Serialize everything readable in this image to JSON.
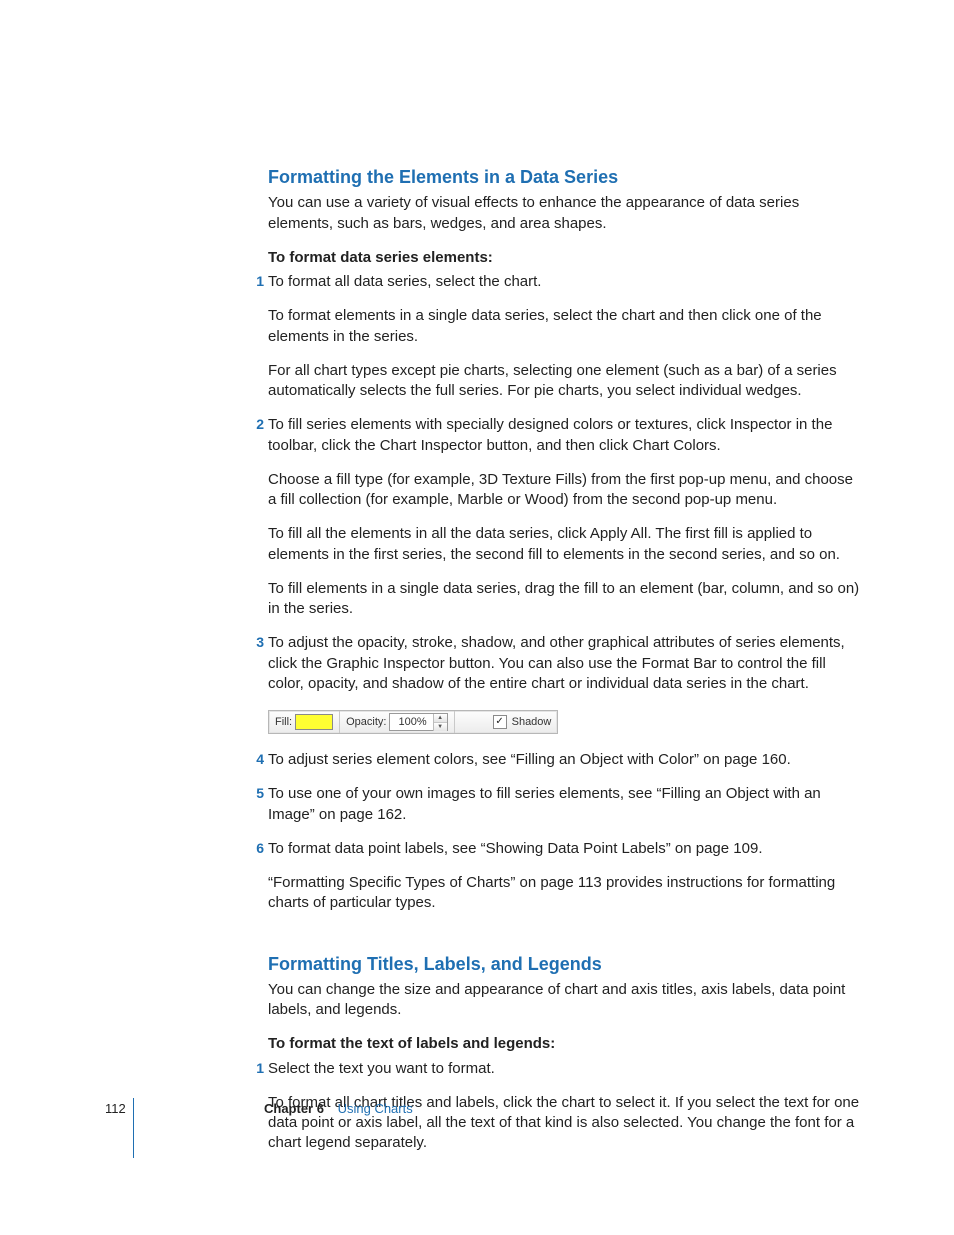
{
  "section1": {
    "heading": "Formatting the Elements in a Data Series",
    "intro": "You can use a variety of visual effects to enhance the appearance of data series elements, such as bars, wedges, and area shapes.",
    "subhead": "To format data series elements:",
    "steps": [
      {
        "num": "1",
        "paras": [
          "To format all data series, select the chart.",
          "To format elements in a single data series, select the chart and then click one of the elements in the series.",
          "For all chart types except pie charts, selecting one element (such as a bar) of a series automatically selects the full series. For pie charts, you select individual wedges."
        ]
      },
      {
        "num": "2",
        "paras": [
          "To fill series elements with specially designed colors or textures, click Inspector in the toolbar, click the Chart Inspector button, and then click Chart Colors.",
          "Choose a fill type (for example, 3D Texture Fills) from the first pop-up menu, and choose a fill collection (for example, Marble or Wood) from the second pop-up menu.",
          "To fill all the elements in all the data series, click Apply All. The first fill is applied to elements in the first series, the second fill to elements in the second series, and so on.",
          "To fill elements in a single data series, drag the fill to an element (bar, column, and so on) in the series."
        ]
      },
      {
        "num": "3",
        "paras": [
          "To adjust the opacity, stroke, shadow, and other graphical attributes of series elements, click the Graphic Inspector button. You can also use the Format Bar to control the fill color, opacity, and shadow of the entire chart or individual data series in the chart."
        ]
      },
      {
        "num": "4",
        "paras": [
          "To adjust series element colors, see “Filling an Object with Color” on page 160."
        ]
      },
      {
        "num": "5",
        "paras": [
          "To use one of your own images to fill series elements, see “Filling an Object with an Image” on page 162."
        ]
      },
      {
        "num": "6",
        "paras": [
          "To format data point labels, see “Showing Data Point Labels” on page 109.",
          "“Formatting Specific Types of Charts” on page 113 provides instructions for formatting charts of particular types."
        ]
      }
    ]
  },
  "formatbar": {
    "fill_label": "Fill:",
    "opacity_label": "Opacity:",
    "opacity_value": "100%",
    "shadow_label": "Shadow",
    "shadow_checked": "✓"
  },
  "section2": {
    "heading": "Formatting Titles, Labels, and Legends",
    "intro": "You can change the size and appearance of chart and axis titles, axis labels, data point labels, and legends.",
    "subhead": "To format the text of labels and legends:",
    "steps": [
      {
        "num": "1",
        "paras": [
          "Select the text you want to format.",
          "To format all chart titles and labels, click the chart to select it. If you select the text for one data point or axis label, all the text of that kind is also selected. You change the font for a chart legend separately."
        ]
      }
    ]
  },
  "footer": {
    "page_number": "112",
    "chapter_label": "Chapter 6",
    "chapter_title": "Using Charts"
  }
}
